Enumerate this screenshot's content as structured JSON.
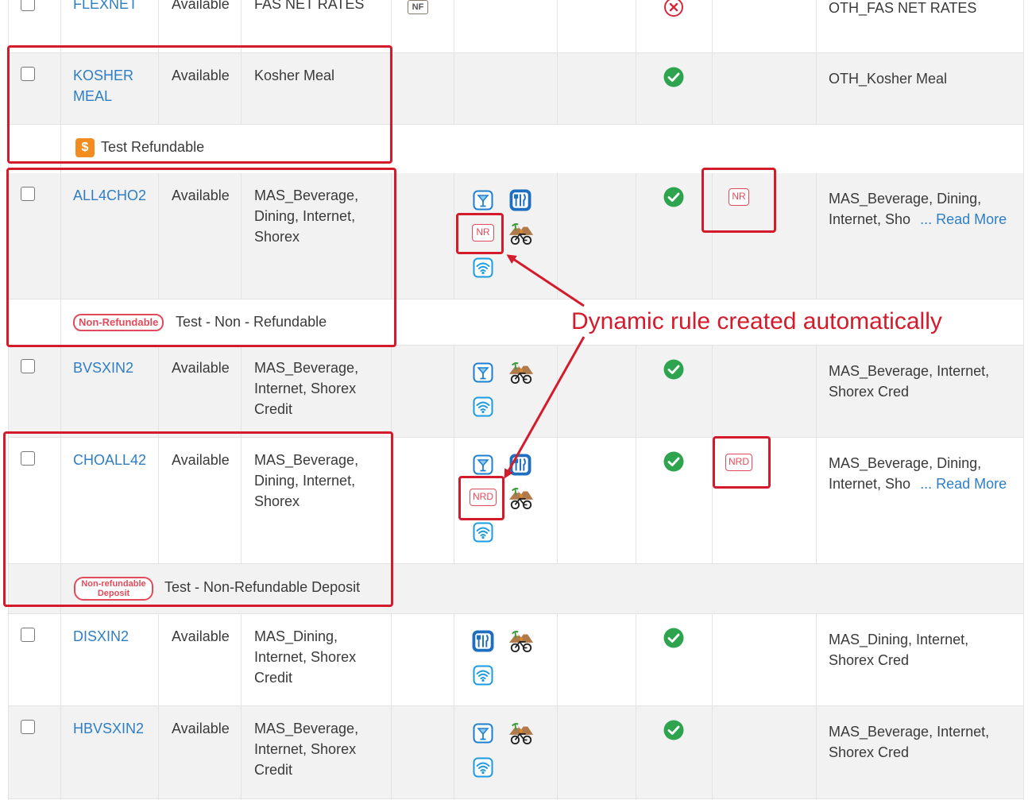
{
  "rows": {
    "flexnet": {
      "code": "FLEXNET",
      "status": "Available",
      "description": "FAS NET RATES",
      "amenity_badge": "NF",
      "extra": "OTH_FAS NET RATES"
    },
    "kosher": {
      "code_line1": "KOSHER",
      "code_line2": "MEAL",
      "status": "Available",
      "description": "Kosher Meal",
      "extra": "OTH_Kosher Meal",
      "policy_icon": "$",
      "policy_text": "Test Refundable"
    },
    "all4cho2": {
      "code": "ALL4CHO2",
      "status": "Available",
      "description": [
        "MAS_Beverage,",
        "Dining, Internet,",
        "Shorex"
      ],
      "amenity_badge": "NR",
      "rule_badge": "NR",
      "extra_line1": "MAS_Beverage, Dining,",
      "extra_line2": "Internet, Sho",
      "read_more": "... Read More",
      "policy_tag": "Non-Refundable",
      "policy_text": "Test - Non - Refundable"
    },
    "bvsxin2": {
      "code": "BVSXIN2",
      "status": "Available",
      "description": [
        "MAS_Beverage,",
        "Internet, Shorex",
        "Credit"
      ],
      "extra_line1": "MAS_Beverage, Internet,",
      "extra_line2": "Shorex Cred"
    },
    "choall42": {
      "code": "CHOALL42",
      "status": "Available",
      "description": [
        "MAS_Beverage,",
        "Dining, Internet,",
        "Shorex"
      ],
      "amenity_badge": "NRD",
      "rule_badge": "NRD",
      "extra_line1": "MAS_Beverage, Dining,",
      "extra_line2": "Internet, Sho",
      "read_more": "... Read More",
      "policy_tag_line1": "Non-refundable",
      "policy_tag_line2": "Deposit",
      "policy_text": "Test - Non-Refundable Deposit"
    },
    "disxin2": {
      "code": "DISXIN2",
      "status": "Available",
      "description": [
        "MAS_Dining,",
        "Internet, Shorex",
        "Credit"
      ],
      "extra_line1": "MAS_Dining, Internet,",
      "extra_line2": "Shorex Cred"
    },
    "hbvsxin2": {
      "code": "HBVSXIN2",
      "status": "Available",
      "description": [
        "MAS_Beverage,",
        "Internet, Shorex",
        "Credit"
      ],
      "extra_line1": "MAS_Beverage, Internet,",
      "extra_line2": "Shorex Cred"
    }
  },
  "annotation": "Dynamic rule created automatically",
  "icons": {
    "drink": "cocktail-icon",
    "dining": "utensils-icon",
    "wifi": "wifi-icon",
    "shorex": "shore-excursion-icon",
    "ok": "check-circle-icon",
    "no": "x-circle-icon"
  },
  "colors": {
    "link": "#2f7ec4",
    "highlight": "#d41b2c",
    "ok": "#2ea44f",
    "row_alt": "#f2f2f2",
    "tag": "#e24b5b"
  }
}
